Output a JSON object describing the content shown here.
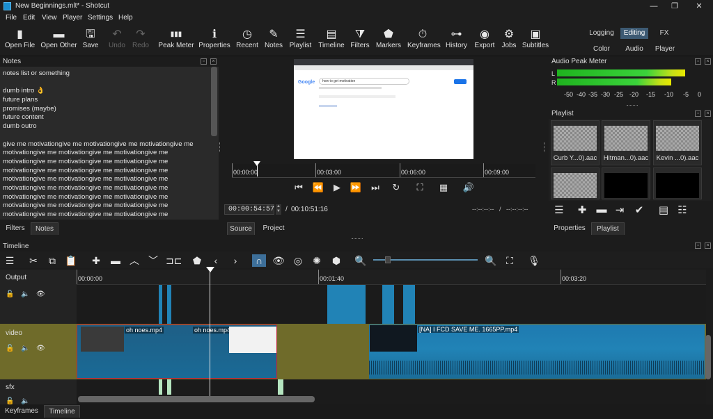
{
  "window": {
    "title": "New Beginnings.mlt* - Shotcut",
    "minimize": "—",
    "maximize": "❐",
    "close": "✕"
  },
  "menu": [
    "File",
    "Edit",
    "View",
    "Player",
    "Settings",
    "Help"
  ],
  "toolbar": [
    {
      "label": "Open File",
      "icon": "open-file-icon",
      "glyph": "▮"
    },
    {
      "label": "Open Other",
      "icon": "open-other-icon",
      "glyph": "▬"
    },
    {
      "label": "Save",
      "icon": "save-icon",
      "glyph": "🖫"
    },
    {
      "label": "Undo",
      "icon": "undo-icon",
      "glyph": "↶",
      "disabled": true
    },
    {
      "label": "Redo",
      "icon": "redo-icon",
      "glyph": "↷",
      "disabled": true
    },
    {
      "label": "Peak Meter",
      "icon": "peak-meter-icon",
      "glyph": "▮▮▮"
    },
    {
      "label": "Properties",
      "icon": "properties-icon",
      "glyph": "ℹ"
    },
    {
      "label": "Recent",
      "icon": "recent-icon",
      "glyph": "◷"
    },
    {
      "label": "Notes",
      "icon": "notes-icon",
      "glyph": "✎"
    },
    {
      "label": "Playlist",
      "icon": "playlist-icon",
      "glyph": "☰"
    },
    {
      "label": "Timeline",
      "icon": "timeline-icon",
      "glyph": "▤"
    },
    {
      "label": "Filters",
      "icon": "filters-icon",
      "glyph": "⧩"
    },
    {
      "label": "Markers",
      "icon": "markers-icon",
      "glyph": "⬟"
    },
    {
      "label": "Keyframes",
      "icon": "keyframes-icon",
      "glyph": "⏱"
    },
    {
      "label": "History",
      "icon": "history-icon",
      "glyph": "⊶"
    },
    {
      "label": "Export",
      "icon": "export-icon",
      "glyph": "◉"
    },
    {
      "label": "Jobs",
      "icon": "jobs-icon",
      "glyph": "⚙"
    },
    {
      "label": "Subtitles",
      "icon": "subtitles-icon",
      "glyph": "▣"
    }
  ],
  "workspaces": {
    "top": [
      "Logging",
      "Editing",
      "FX"
    ],
    "bottom": [
      "Color",
      "Audio",
      "Player"
    ]
  },
  "notes_panel": {
    "title": "Notes",
    "lines": [
      "notes list or something",
      "",
      "dumb intro 👌",
      "future plans",
      "promises (maybe)",
      "future content",
      "dumb outro",
      "",
      "give me motivationgive me motivationgive me motivationgive me",
      "motivationgive me motivationgive me motivationgive me",
      "motivationgive me motivationgive me motivationgive me",
      "motivationgive me motivationgive me motivationgive me",
      "motivationgive me motivationgive me motivationgive me",
      "motivationgive me motivationgive me motivationgive me",
      "motivationgive me motivationgive me motivationgive me",
      "motivationgive me motivationgive me motivationgive me",
      "motivationgive me motivationgive me motivationgive me"
    ],
    "tabs": [
      "Filters",
      "Notes"
    ]
  },
  "player": {
    "ruler": [
      "00:00:00",
      "00:03:00",
      "00:06:00",
      "00:09:00"
    ],
    "current_time": "00:00:54:57",
    "separator": "/",
    "duration": "00:10:51:16",
    "in_point": "--:--:--:--",
    "out_point": "--:--:--:--",
    "tabs": [
      "Source",
      "Project"
    ],
    "frame": {
      "search_text": "how to get motivation",
      "logo": "Google"
    }
  },
  "audio_meter": {
    "title": "Audio Peak Meter",
    "left_label": "L",
    "right_label": "R",
    "left_level": 0.93,
    "right_level": 0.83,
    "scale": [
      "-50",
      "-40",
      "-35",
      "-30",
      "-25",
      "-20",
      "-15",
      "-10",
      "-5",
      "0"
    ]
  },
  "playlist": {
    "title": "Playlist",
    "items": [
      "Curb Y...0).aac",
      "Hitman...0).aac",
      "Kevin ...0).aac",
      "",
      "",
      ""
    ],
    "tabs": [
      "Properties",
      "Playlist"
    ]
  },
  "timeline": {
    "title": "Timeline",
    "ruler": [
      "00:00:00",
      "00:01:40",
      "00:03:20"
    ],
    "tracks": [
      {
        "name": "Output"
      },
      {
        "name": "video"
      },
      {
        "name": "sfx"
      }
    ],
    "clips": [
      "oh noes.mp4",
      "oh noes.mp4",
      "[NA] I FCD SAVE ME. 1665PP.mp4"
    ]
  },
  "bottom_tabs": [
    "Keyframes",
    "Timeline"
  ],
  "colors": {
    "accent": "#2183b6",
    "video_track": "#6f6b2a",
    "selected_clip_border": "#c0283a"
  }
}
